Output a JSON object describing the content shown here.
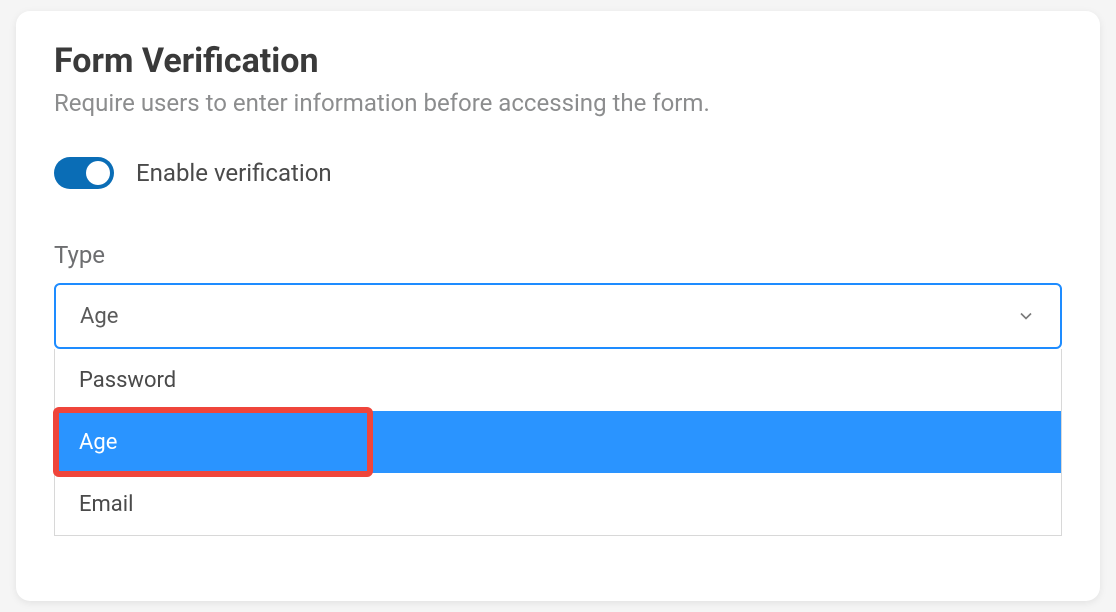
{
  "heading": "Form Verification",
  "subheading": "Require users to enter information before accessing the form.",
  "toggle": {
    "label": "Enable verification",
    "on": true
  },
  "type_field": {
    "label": "Type",
    "selected": "Age",
    "options": [
      "Password",
      "Age",
      "Email"
    ],
    "highlighted": "Age"
  }
}
